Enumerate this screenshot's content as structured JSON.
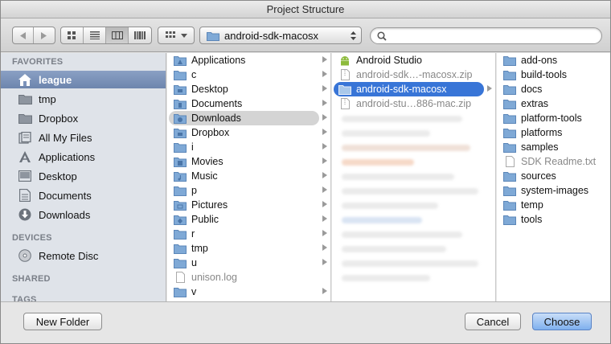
{
  "window": {
    "title": "Project Structure"
  },
  "toolbar": {
    "location": "android-sdk-macosx",
    "search_placeholder": ""
  },
  "sidebar": {
    "favorites_header": "FAVORITES",
    "devices_header": "DEVICES",
    "shared_header": "SHARED",
    "tags_header": "TAGS",
    "favorites": [
      {
        "label": "league",
        "icon": "home-icon"
      },
      {
        "label": "tmp",
        "icon": "folder-icon"
      },
      {
        "label": "Dropbox",
        "icon": "folder-icon"
      },
      {
        "label": "All My Files",
        "icon": "all-files-icon"
      },
      {
        "label": "Applications",
        "icon": "applications-icon"
      },
      {
        "label": "Desktop",
        "icon": "desktop-icon"
      },
      {
        "label": "Documents",
        "icon": "documents-icon"
      },
      {
        "label": "Downloads",
        "icon": "downloads-icon"
      }
    ],
    "devices": [
      {
        "label": "Remote Disc",
        "icon": "disc-icon"
      }
    ]
  },
  "column1": [
    {
      "label": "Applications"
    },
    {
      "label": "c"
    },
    {
      "label": "Desktop"
    },
    {
      "label": "Documents"
    },
    {
      "label": "Downloads"
    },
    {
      "label": "Dropbox"
    },
    {
      "label": "i"
    },
    {
      "label": "Movies"
    },
    {
      "label": "Music"
    },
    {
      "label": "p"
    },
    {
      "label": "Pictures"
    },
    {
      "label": "Public"
    },
    {
      "label": "r"
    },
    {
      "label": "tmp"
    },
    {
      "label": "u"
    },
    {
      "label": "unison.log"
    },
    {
      "label": "v"
    }
  ],
  "column2": [
    {
      "label": "Android Studio"
    },
    {
      "label": "android-sdk…-macosx.zip"
    },
    {
      "label": "android-sdk-macosx"
    },
    {
      "label": "android-stu…886-mac.zip"
    }
  ],
  "column3": [
    {
      "label": "add-ons"
    },
    {
      "label": "build-tools"
    },
    {
      "label": "docs"
    },
    {
      "label": "extras"
    },
    {
      "label": "platform-tools"
    },
    {
      "label": "platforms"
    },
    {
      "label": "samples"
    },
    {
      "label": "SDK Readme.txt"
    },
    {
      "label": "sources"
    },
    {
      "label": "system-images"
    },
    {
      "label": "temp"
    },
    {
      "label": "tools"
    }
  ],
  "buttons": {
    "new_folder": "New Folder",
    "cancel": "Cancel",
    "choose": "Choose"
  },
  "colors": {
    "folder": "#7fa9d6",
    "selection_blue": "#3875d7",
    "selection_grey": "#d4d4d4",
    "sidebar_bg": "#dfe3e9"
  }
}
